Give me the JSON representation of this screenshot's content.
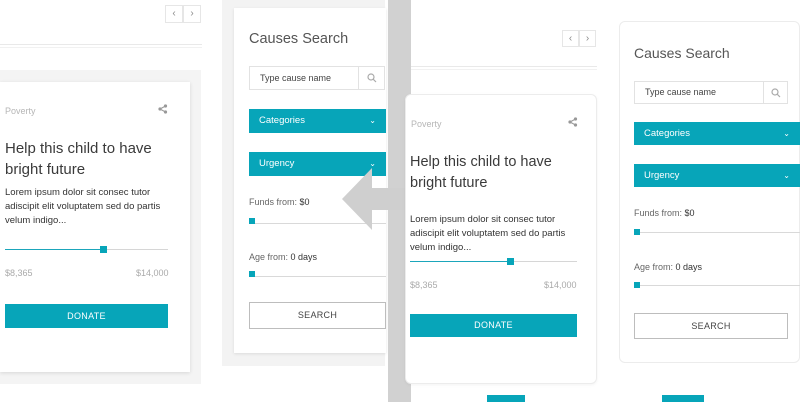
{
  "colors": {
    "accent": "#07a5b9",
    "divider": "#d1d1d1"
  },
  "nav": {
    "prev": "‹",
    "next": "›"
  },
  "cause_card": {
    "category": "Poverty",
    "share_icon": "share-icon",
    "title": "Help this child to have bright future",
    "description": "Lorem ipsum dolor sit consec tutor adiscipit elit voluptatem sed do partis velum indigo...",
    "raised": "$8,365",
    "goal": "$14,000",
    "progress_fraction": 0.6,
    "donate_label": "DONATE"
  },
  "search_panel": {
    "title": "Causes Search",
    "placeholder": "Type cause name",
    "search_icon": "search-icon",
    "categories_label": "Categories",
    "urgency_label": "Urgency",
    "funds_label": "Funds from:",
    "funds_value": "$0",
    "age_label": "Age from:",
    "age_value": "0 days",
    "search_button": "SEARCH"
  },
  "comparison_arrow_icon": "double-arrow-icon"
}
